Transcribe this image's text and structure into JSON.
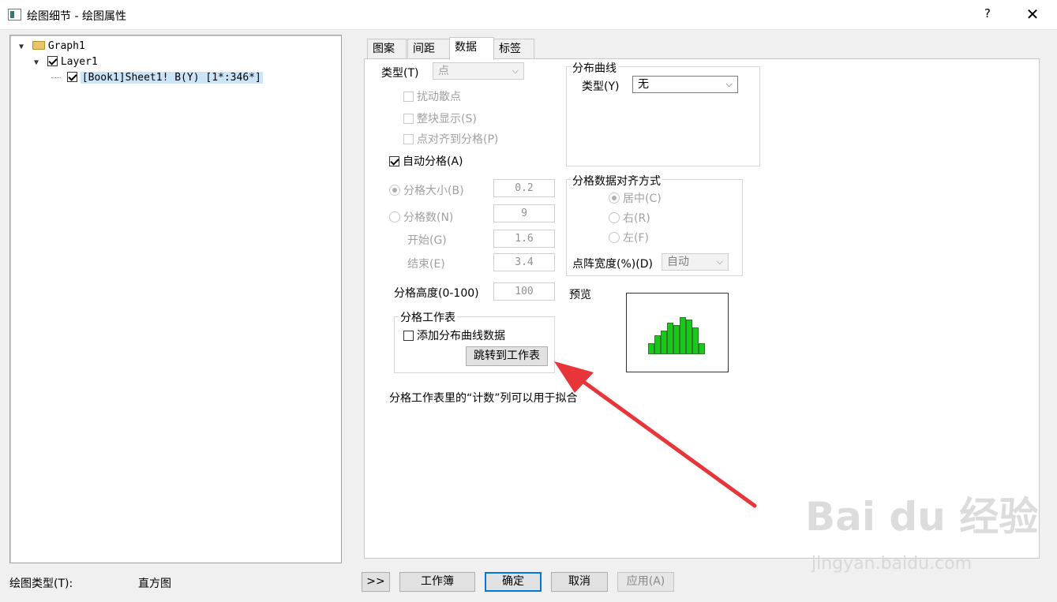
{
  "window": {
    "title": "绘图细节 - 绘图属性",
    "help_label": "?",
    "close_label": "✕"
  },
  "tree": {
    "items": [
      {
        "label": "Graph1",
        "level": 0,
        "expanded": true
      },
      {
        "label": "Layer1",
        "level": 1,
        "expanded": true,
        "checked": true
      },
      {
        "label": "[Book1]Sheet1! B(Y) [1*:346*]",
        "level": 2,
        "checked": true,
        "selected": true
      }
    ]
  },
  "tabs": [
    {
      "label": "图案",
      "active": false
    },
    {
      "label": "间距",
      "active": false
    },
    {
      "label": "数据",
      "active": true
    },
    {
      "label": "标签",
      "active": false
    }
  ],
  "data_tab": {
    "type_label": "类型(T)",
    "type_value": "点",
    "jitter_label": "扰动散点",
    "block_label": "整块显示(S)",
    "align_label": "点对齐到分格(P)",
    "auto_bin_label": "自动分格(A)",
    "bin_size_label": "分格大小(B)",
    "bin_size_value": "0.2",
    "bin_count_label": "分格数(N)",
    "bin_count_value": "9",
    "begin_label": "开始(G)",
    "begin_value": "1.6",
    "end_label": "结束(E)",
    "end_value": "3.4",
    "bin_height_label": "分格高度(0-100)",
    "bin_height_value": "100",
    "worksheet_group_title": "分格工作表",
    "add_curve_label": "添加分布曲线数据",
    "goto_worksheet_label": "跳转到工作表",
    "note_text": "分格工作表里的“计数”列可以用于拟合",
    "distribution": {
      "title": "分布曲线",
      "type_label": "类型(Y)",
      "type_value": "无"
    },
    "alignment": {
      "title": "分格数据对齐方式",
      "center_label": "居中(C)",
      "right_label": "右(R)",
      "left_label": "左(F)",
      "dot_width_label": "点阵宽度(%)(D)",
      "dot_width_value": "自动"
    },
    "preview_label": "预览",
    "preview_bars": [
      0.27,
      0.47,
      0.6,
      0.8,
      0.73,
      0.93,
      0.88,
      0.67,
      0.27
    ]
  },
  "footer": {
    "plot_type_label": "绘图类型(T):",
    "plot_type_value": "直方图",
    "expand_label": ">>",
    "workbook_label": "工作簿",
    "ok_label": "确定",
    "cancel_label": "取消",
    "apply_label": "应用(A)"
  },
  "watermark": {
    "text": "Bai du 经验",
    "url": "jingyan.baidu.com"
  },
  "colors": {
    "accent": "#0078d7",
    "arrow": "#e8353a",
    "preview_bar": "#19c819"
  }
}
